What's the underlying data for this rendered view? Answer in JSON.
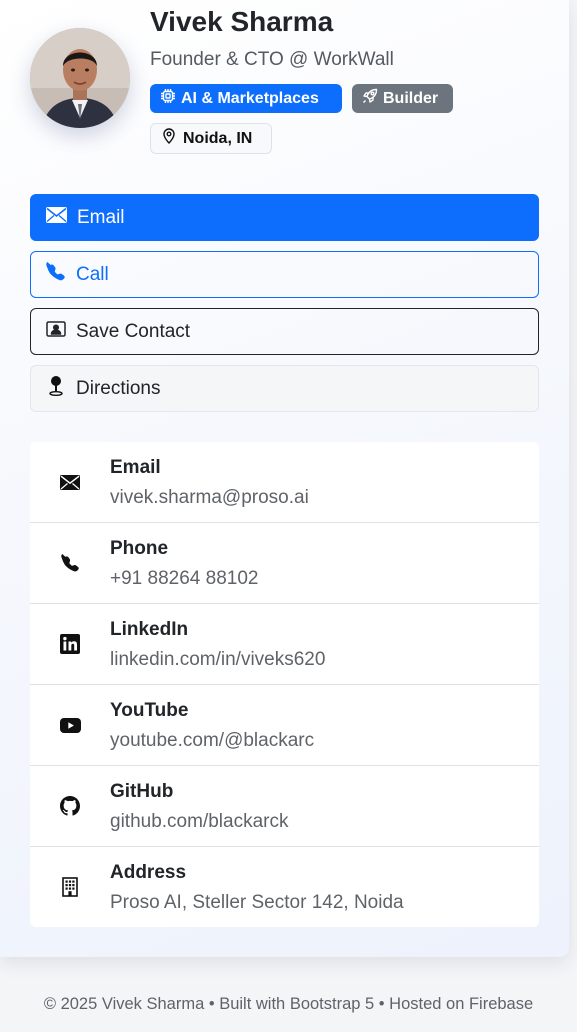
{
  "profile": {
    "name": "Vivek Sharma",
    "subtitle": "Founder & CTO @ WorkWall",
    "badges": [
      {
        "label": "AI & Marketplaces",
        "icon": "cpu-icon",
        "color": "#0d6efd"
      },
      {
        "label": "Builder",
        "icon": "rocket-icon",
        "color": "#6c757d"
      }
    ],
    "location": {
      "label": "Noida, IN",
      "icon": "geo-pin-icon"
    }
  },
  "actions": {
    "email": {
      "label": "Email",
      "icon": "envelope-icon"
    },
    "call": {
      "label": "Call",
      "icon": "phone-icon"
    },
    "save": {
      "label": "Save Contact",
      "icon": "person-vcard-icon"
    },
    "directions": {
      "label": "Directions",
      "icon": "pin-icon"
    }
  },
  "contacts": [
    {
      "label": "Email",
      "value": "vivek.sharma@proso.ai",
      "icon": "envelope-icon"
    },
    {
      "label": "Phone",
      "value": "+91 88264 88102",
      "icon": "phone-icon"
    },
    {
      "label": "LinkedIn",
      "value": "linkedin.com/in/viveks620",
      "icon": "linkedin-icon"
    },
    {
      "label": "YouTube",
      "value": "youtube.com/@blackarc",
      "icon": "youtube-icon"
    },
    {
      "label": "GitHub",
      "value": "github.com/blackarck",
      "icon": "github-icon"
    },
    {
      "label": "Address",
      "value": "Proso AI, Steller Sector 142, Noida",
      "icon": "building-icon"
    }
  ],
  "footer": {
    "text": "© 2025 Vivek Sharma • Built with Bootstrap 5 • Hosted on Firebase"
  },
  "colors": {
    "primary": "#0d6efd",
    "secondary": "#6c757d",
    "dark": "#212529"
  }
}
